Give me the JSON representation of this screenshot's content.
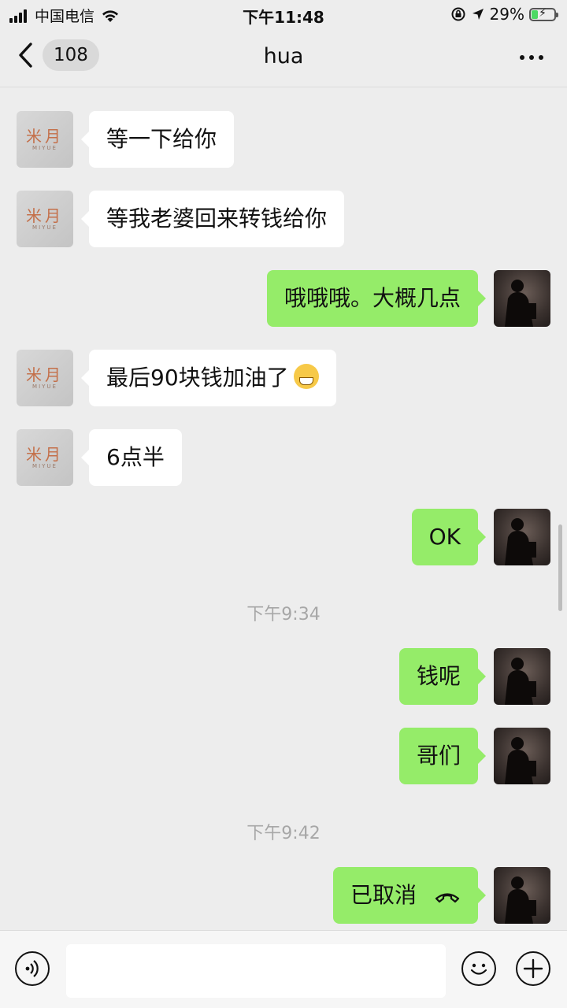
{
  "status_bar": {
    "carrier": "中国电信",
    "time": "下午11:48",
    "battery": "29%",
    "battery_level": 0.29,
    "icons": [
      "signal-icon",
      "wifi-icon",
      "orientation-lock-icon",
      "location-icon",
      "battery-icon"
    ]
  },
  "nav": {
    "back_badge": "108",
    "title": "hua",
    "icons": [
      "back-chevron-icon",
      "more-icon"
    ]
  },
  "messages": [
    {
      "side": "in",
      "text": "等一下给你"
    },
    {
      "side": "in",
      "text": "等我老婆回来转钱给你"
    },
    {
      "side": "out",
      "text": "哦哦哦。大概几点"
    },
    {
      "side": "in",
      "text": "最后90块钱加油了",
      "emoji": "grinning-face"
    },
    {
      "side": "in",
      "text": "6点半"
    },
    {
      "side": "out",
      "text": "OK"
    },
    {
      "type": "time",
      "text": "下午9:34"
    },
    {
      "side": "out",
      "text": "钱呢"
    },
    {
      "side": "out",
      "text": "哥们"
    },
    {
      "type": "time",
      "text": "下午9:42"
    },
    {
      "side": "out",
      "text": "已取消",
      "icon": "call-cancelled-icon"
    }
  ],
  "contact_avatar": {
    "brand": "米月",
    "sub": "MIYUE"
  },
  "input_bar": {
    "placeholder": "",
    "icons": [
      "voice-icon",
      "emoji-icon",
      "plus-icon"
    ]
  },
  "colors": {
    "background": "#ededed",
    "outgoing_bubble": "#95ec69",
    "incoming_bubble": "#ffffff",
    "timestamp": "#a7a7a7"
  }
}
